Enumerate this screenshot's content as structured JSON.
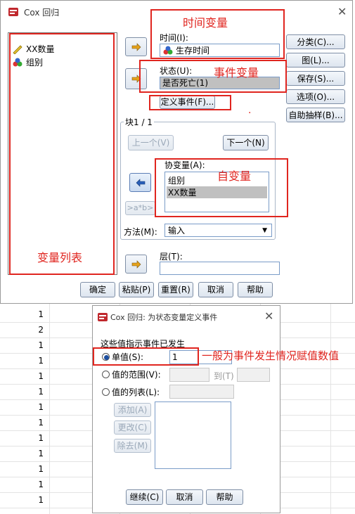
{
  "sheet": {
    "values": [
      "1",
      "2",
      "1",
      "1",
      "1",
      "1",
      "1",
      "1",
      "1",
      "1",
      "1",
      "1",
      "1"
    ]
  },
  "main_dialog": {
    "title": "Cox 回归",
    "variable_list": [
      {
        "label": "XX数量",
        "icon": "ruler-icon"
      },
      {
        "label": "组别",
        "icon": "nominal-icon"
      }
    ],
    "time_label": "时间(I):",
    "time_value": "生存时间",
    "status_label": "状态(U):",
    "status_value": "是否死亡(1)",
    "define_event_label": "定义事件(F)...",
    "block_label": "块1 / 1",
    "prev_label": "上一个(V)",
    "next_label": "下一个(N)",
    "covariates_label": "协变量(A):",
    "covariates": [
      "组别",
      "XX数量"
    ],
    "interaction_label": ">a*b>",
    "method_label": "方法(M):",
    "method_value": "输入",
    "strata_label": "层(T):",
    "side_buttons": [
      "分类(C)...",
      "图(L)...",
      "保存(S)...",
      "选项(O)...",
      "自助抽样(B)..."
    ],
    "bottom_buttons": [
      "确定",
      "粘贴(P)",
      "重置(R)",
      "取消",
      "帮助"
    ],
    "annotations": {
      "time_var": "时间变量",
      "event_var": "事件变量",
      "independent_var": "自变量",
      "var_list": "变量列表",
      "single_value_note": "一般为事件发生情况赋值数值",
      "dot": "."
    }
  },
  "event_dialog": {
    "title": "Cox 回归: 为状态变量定义事件",
    "group_label": "这些值指示事件已发生",
    "single_label": "单值(S):",
    "single_value": "1",
    "range_label": "值的范围(V):",
    "range_to": "到(T)",
    "list_label": "值的列表(L):",
    "add_label": "添加(A)",
    "change_label": "更改(C)",
    "remove_label": "除去(M)",
    "bottom_buttons": [
      "继续(C)",
      "取消",
      "帮助"
    ]
  },
  "colors": {
    "annotation_red": "#e0251f",
    "selected_row": "#c0c0c0"
  }
}
